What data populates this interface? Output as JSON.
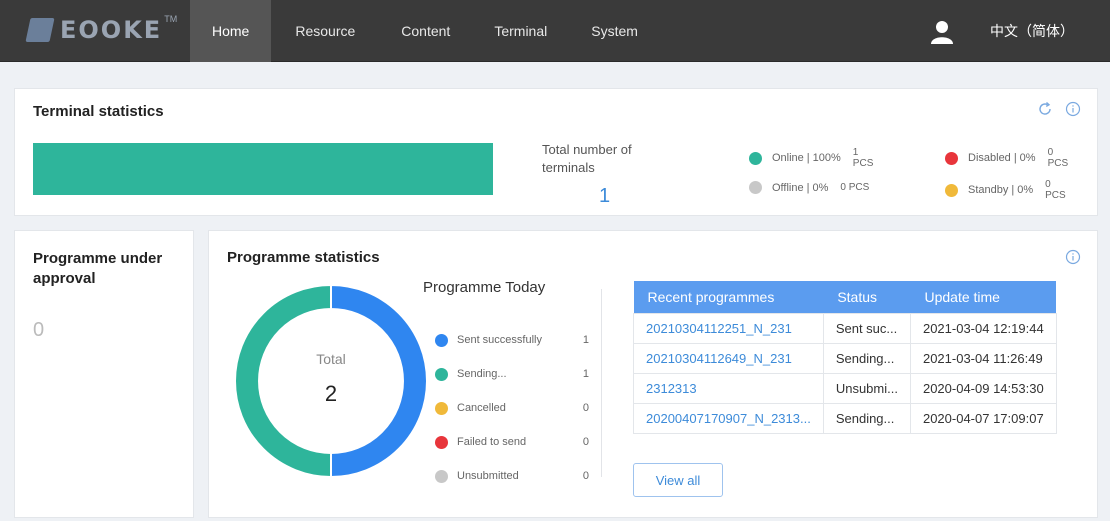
{
  "header": {
    "logo_text": "EOOKE",
    "logo_tm": "TM",
    "nav": [
      {
        "label": "Home"
      },
      {
        "label": "Resource"
      },
      {
        "label": "Content"
      },
      {
        "label": "Terminal"
      },
      {
        "label": "System"
      }
    ],
    "language": "中文（简体）"
  },
  "terminal_stats": {
    "title": "Terminal statistics",
    "online_fraction": 1.0,
    "total_label": "Total number of terminals",
    "total_value": "1",
    "legend": [
      {
        "label": "Online",
        "percent": "100%",
        "count": "1",
        "unit": "PCS",
        "color": "#2eb59b"
      },
      {
        "label": "Offline",
        "percent": "0%",
        "count": "0",
        "unit": "PCS",
        "color": "#c8c8c8"
      },
      {
        "label": "Disabled",
        "percent": "0%",
        "count": "0",
        "unit": "PCS",
        "color": "#e8353b"
      },
      {
        "label": "Standby",
        "percent": "0%",
        "count": "0",
        "unit": "PCS",
        "color": "#f0b93a"
      }
    ]
  },
  "approval": {
    "title": "Programme under approval",
    "count": "0"
  },
  "programme_stats": {
    "title": "Programme statistics",
    "total_label": "Total",
    "total_value": "2",
    "today_title": "Programme Today",
    "today": [
      {
        "label": "Sent successfully",
        "value": "1",
        "color": "#2f86f0"
      },
      {
        "label": "Sending...",
        "value": "1",
        "color": "#2eb59b"
      },
      {
        "label": "Cancelled",
        "value": "0",
        "color": "#f0b93a"
      },
      {
        "label": "Failed to send",
        "value": "0",
        "color": "#e8353b"
      },
      {
        "label": "Unsubmitted",
        "value": "0",
        "color": "#c8c8c8"
      }
    ],
    "recent": {
      "headers": [
        "Recent programmes",
        "Status",
        "Update time"
      ],
      "rows": [
        [
          "20210304112251_N_231",
          "Sent suc...",
          "2021-03-04 12:19:44"
        ],
        [
          "20210304112649_N_231",
          "Sending...",
          "2021-03-04 11:26:49"
        ],
        [
          "2312313",
          "Unsubmi...",
          "2020-04-09 14:53:30"
        ],
        [
          "20200407170907_N_2313...",
          "Sending...",
          "2020-04-07 17:09:07"
        ]
      ]
    },
    "view_all": "View all"
  }
}
